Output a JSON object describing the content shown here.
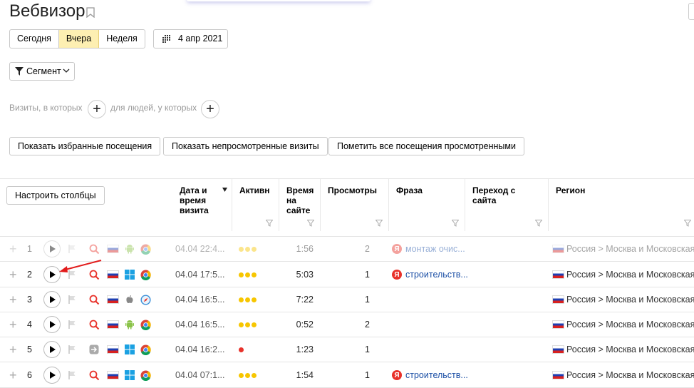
{
  "page": {
    "title": "Вебвизор"
  },
  "period": {
    "options": [
      "Сегодня",
      "Вчера",
      "Неделя"
    ],
    "selected": "Вчера",
    "date": "4 апр 2021"
  },
  "segment": {
    "label": "Сегмент"
  },
  "conditions": {
    "visits_label": "Визиты, в которых",
    "people_label": "для людей, у которых"
  },
  "actions": {
    "show_favorites": "Показать избранные посещения",
    "show_unviewed": "Показать непросмотренные визиты",
    "mark_all_viewed": "Пометить все посещения просмотренными"
  },
  "table": {
    "configure_label": "Настроить столбцы",
    "columns": {
      "date": "Дата и время визита",
      "activity": "Активн",
      "time": "Время на сайте",
      "views": "Просмотры",
      "phrase": "Фраза",
      "referrer": "Переход с сайта",
      "region": "Регион"
    },
    "rows": [
      {
        "num": "1",
        "date": "04.04 22:4...",
        "activity": 3,
        "time": "1:56",
        "views": "2",
        "phrase": "монтаж очис...",
        "region": "Россия > Москва и Московская ...",
        "os": "android",
        "browser": "chrome",
        "faded": true
      },
      {
        "num": "2",
        "date": "04.04 17:5...",
        "activity": 3,
        "time": "5:03",
        "views": "1",
        "phrase": "строительств...",
        "region": "Россия > Москва и Московская ...",
        "os": "windows",
        "browser": "chrome",
        "faded": false
      },
      {
        "num": "3",
        "date": "04.04 16:5...",
        "activity": 3,
        "time": "7:22",
        "views": "1",
        "phrase": "",
        "region": "Россия > Москва и Московская ...",
        "os": "apple",
        "browser": "safari",
        "faded": false
      },
      {
        "num": "4",
        "date": "04.04 16:5...",
        "activity": 3,
        "time": "0:52",
        "views": "2",
        "phrase": "",
        "region": "Россия > Москва и Московская ...",
        "os": "android",
        "browser": "chrome",
        "faded": false
      },
      {
        "num": "5",
        "date": "04.04 16:2...",
        "activity": 1,
        "time": "1:23",
        "views": "1",
        "phrase": "",
        "region": "Россия > Москва и Московская ...",
        "os": "windows",
        "browser": "chrome",
        "faded": false
      },
      {
        "num": "6",
        "date": "04.04 07:1...",
        "activity": 3,
        "time": "1:54",
        "views": "1",
        "phrase": "строительств...",
        "region": "Россия > Москва и Московская ...",
        "os": "windows",
        "browser": "chrome",
        "faded": false
      }
    ]
  }
}
